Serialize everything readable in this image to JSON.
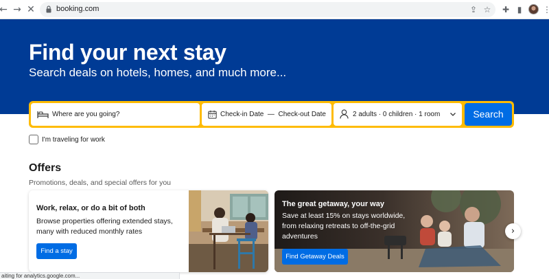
{
  "browser": {
    "url": "booking.com"
  },
  "hero": {
    "title": "Find your next stay",
    "subtitle": "Search deals on hotels, homes, and much more..."
  },
  "search": {
    "destination_placeholder": "Where are you going?",
    "dates_label": "Check-in Date  —  Check-out Date",
    "guests_label": "2 adults · 0 children · 1 room",
    "button_label": "Search",
    "work_label": "I'm traveling for work",
    "work_checked": false
  },
  "offers": {
    "title": "Offers",
    "subtitle": "Promotions, deals, and special offers for you",
    "cards": [
      {
        "title": "Work, relax, or do a bit of both",
        "description": "Browse properties offering extended stays, many with reduced monthly rates",
        "button": "Find a stay"
      },
      {
        "title": "The great getaway, your way",
        "description": "Save at least 15% on stays worldwide, from relaxing retreats to off-the-grid adventures",
        "button": "Find Getaway Deals"
      }
    ]
  },
  "status": {
    "text": "aiting for analytics.google.com..."
  },
  "colors": {
    "brand_blue": "#003b95",
    "accent_yellow": "#febb02",
    "button_blue": "#006ce4"
  }
}
